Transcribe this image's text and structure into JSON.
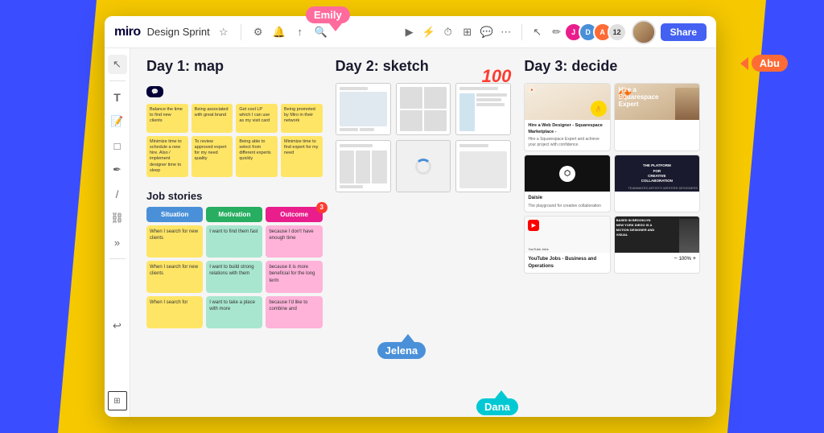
{
  "background": {
    "color": "#F5C800",
    "left_shape_color": "#3B4EFF",
    "right_shape_color": "#3B4EFF"
  },
  "toolbar": {
    "logo": "miro",
    "board_name": "Design Sprint",
    "icons": [
      "gear",
      "bell",
      "upload",
      "search"
    ],
    "right_icons": [
      "lightning",
      "clock",
      "grid",
      "chat",
      "more"
    ],
    "avatar_count": "12",
    "share_label": "Share"
  },
  "cursors": {
    "emily": {
      "name": "Emily"
    },
    "jelena": {
      "name": "Jelena"
    },
    "abu": {
      "name": "Abu"
    },
    "dana": {
      "name": "Dana"
    }
  },
  "columns": {
    "col1_title": "Day 1: map",
    "col2_title": "Day 2: sketch",
    "col3_title": "Day 3: decide"
  },
  "col1": {
    "stickies": [
      {
        "text": "Balance the time to find new clients",
        "color": "yellow"
      },
      {
        "text": "Being associated with great brand",
        "color": "yellow"
      },
      {
        "text": "Get cool LP which I can use as my visit card",
        "color": "yellow"
      },
      {
        "text": "Being promoted by Miro in their network",
        "color": "yellow"
      },
      {
        "text": "Minimize time to schedule a new hire. Also / implement designer time to sleep",
        "color": "yellow"
      },
      {
        "text": "To review approved expert for my need quality",
        "color": "yellow"
      },
      {
        "text": "Being able to select from different experts quickly",
        "color": "yellow"
      },
      {
        "text": "Minimize time to find expert for my need",
        "color": "yellow"
      }
    ],
    "job_stories_title": "Job stories",
    "headers": [
      "Situation",
      "Motivation",
      "Outcome"
    ],
    "header_colors": [
      "blue",
      "green",
      "pink"
    ],
    "badge_count": "3",
    "cards": [
      [
        "When I search for new clients",
        "I want to find them fast",
        "because I don't have enough time"
      ],
      [
        "When I search for new clients",
        "I want to build strong relations with them",
        "because it is more beneficial for the long term"
      ],
      [
        "When I search for",
        "I want to take a place with more",
        "because I'd like to combine and"
      ]
    ]
  },
  "col2": {
    "score": "100",
    "sketches_count": 6,
    "has_loading": true
  },
  "col3": {
    "cards": [
      {
        "title": "Hire a Web Designer - Squarespace Marketplace -",
        "text": "Hire a Squarespace Expert and achieve your project with confidence. Find Squarespace Experts on Tailwind for your website design projects and other creative projects. Find a Squarespace Expert today.",
        "img_style": "light",
        "logo": true
      },
      {
        "title": "Hire a Squarespace Expert",
        "img_style": "light2",
        "text": ""
      },
      {
        "title": "Daisie",
        "text": "The playground for creative collaboration",
        "img_style": "dark"
      },
      {
        "title": "THE PLATFORM FOR CREATIVE COLLABORATION",
        "img_style": "dark2",
        "text": ""
      },
      {
        "title": "YouTube Jobs - Business and Operations",
        "text": "",
        "img_style": "gray"
      },
      {
        "title": "BASED IN BROOKLYN NEW YORK DIEGO IS A MOTION DESIGNER AND VISUAL",
        "img_style": "dark3",
        "text": ""
      }
    ]
  },
  "zoom": {
    "level": "100%",
    "minus_label": "−",
    "plus_label": "+"
  }
}
